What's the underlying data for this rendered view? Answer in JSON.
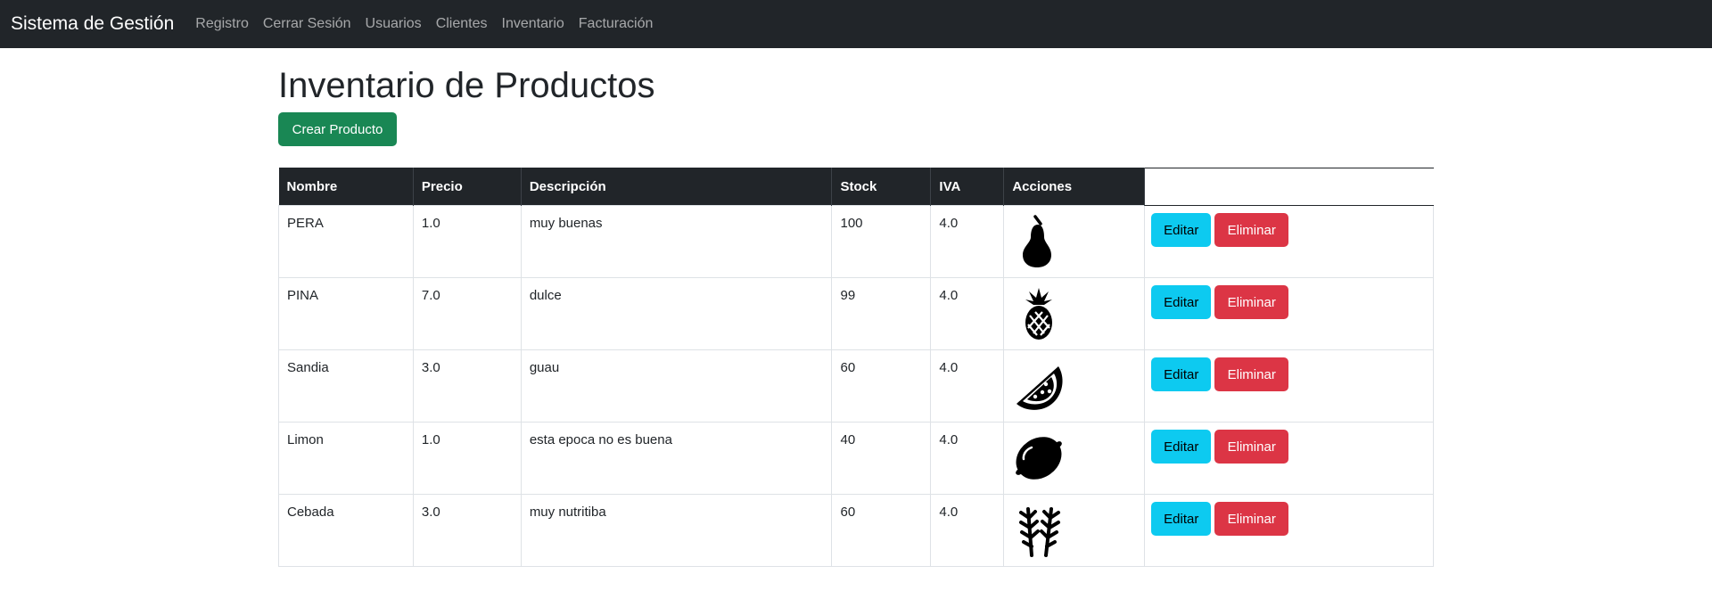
{
  "nav": {
    "brand": "Sistema de Gestión",
    "links": [
      "Registro",
      "Cerrar Sesión",
      "Usuarios",
      "Clientes",
      "Inventario",
      "Facturación"
    ]
  },
  "page": {
    "title": "Inventario de Productos",
    "create_label": "Crear Producto"
  },
  "table": {
    "headers": [
      "Nombre",
      "Precio",
      "Descripción",
      "Stock",
      "IVA",
      "Acciones"
    ],
    "edit_label": "Editar",
    "delete_label": "Eliminar",
    "rows": [
      {
        "nombre": "PERA",
        "precio": "1.0",
        "descripcion": "muy buenas",
        "stock": "100",
        "iva": "4.0",
        "icon": "pear-icon"
      },
      {
        "nombre": "PINA",
        "precio": "7.0",
        "descripcion": "dulce",
        "stock": "99",
        "iva": "4.0",
        "icon": "pineapple-icon"
      },
      {
        "nombre": "Sandia",
        "precio": "3.0",
        "descripcion": "guau",
        "stock": "60",
        "iva": "4.0",
        "icon": "watermelon-icon"
      },
      {
        "nombre": "Limon",
        "precio": "1.0",
        "descripcion": "esta epoca no es buena",
        "stock": "40",
        "iva": "4.0",
        "icon": "lemon-icon"
      },
      {
        "nombre": "Cebada",
        "precio": "3.0",
        "descripcion": "muy nutritiba",
        "stock": "60",
        "iva": "4.0",
        "icon": "wheat-icon"
      }
    ]
  },
  "colors": {
    "navbar": "#212529",
    "success": "#198754",
    "info": "#0dcaf0",
    "danger": "#dc3545"
  }
}
